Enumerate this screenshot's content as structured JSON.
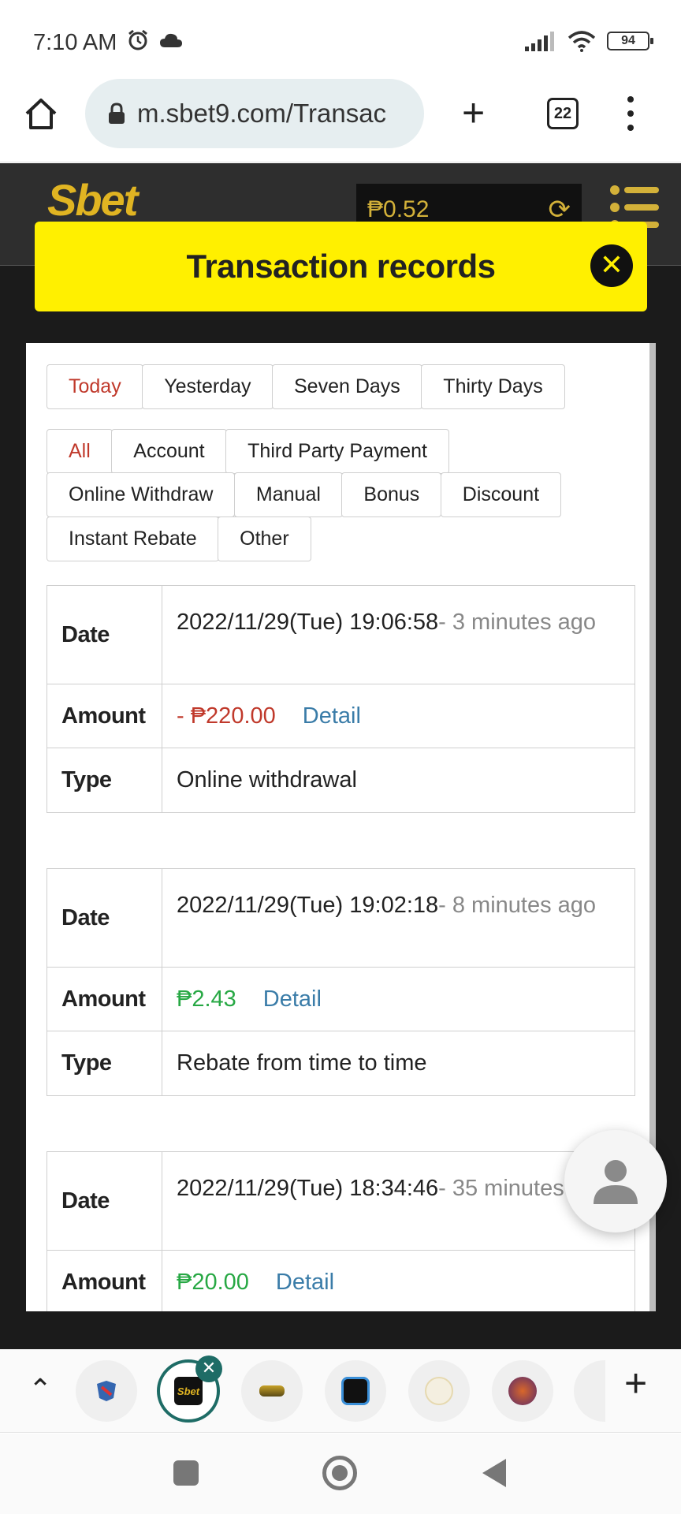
{
  "status_bar": {
    "time": "7:10 AM",
    "battery": "94"
  },
  "browser": {
    "url": "m.sbet9.com/Transac",
    "tab_count": "22"
  },
  "site": {
    "logo_text": "Sbet",
    "balance": "₱0.52"
  },
  "modal": {
    "title": "Transaction records",
    "date_filters": [
      "Today",
      "Yesterday",
      "Seven Days",
      "Thirty Days"
    ],
    "type_filters": [
      "All",
      "Account",
      "Third Party Payment",
      "Online Withdraw",
      "Manual",
      "Bonus",
      "Discount",
      "Instant Rebate",
      "Other"
    ],
    "labels": {
      "date": "Date",
      "amount": "Amount",
      "type": "Type",
      "detail": "Detail"
    },
    "records": [
      {
        "date": "2022/11/29(Tue) 19:06:58",
        "ago": "- 3 minutes ago",
        "amount": "- ₱220.00",
        "type": "Online withdrawal"
      },
      {
        "date": "2022/11/29(Tue) 19:02:18",
        "ago": "- 8 minutes ago",
        "amount": "₱2.43",
        "type": "Rebate from time to time"
      },
      {
        "date": "2022/11/29(Tue) 18:34:46",
        "ago": "- 35 minutes ago",
        "amount": "₱20.00",
        "type": ""
      }
    ]
  },
  "tabstrip": {
    "active_tab_text": "Sbet"
  },
  "colors": {
    "accent_yellow": "#fff000",
    "gold": "#d3b139",
    "negative": "#c0392b",
    "positive": "#27a844",
    "link": "#3a7ca8",
    "teal": "#1e6c66"
  }
}
